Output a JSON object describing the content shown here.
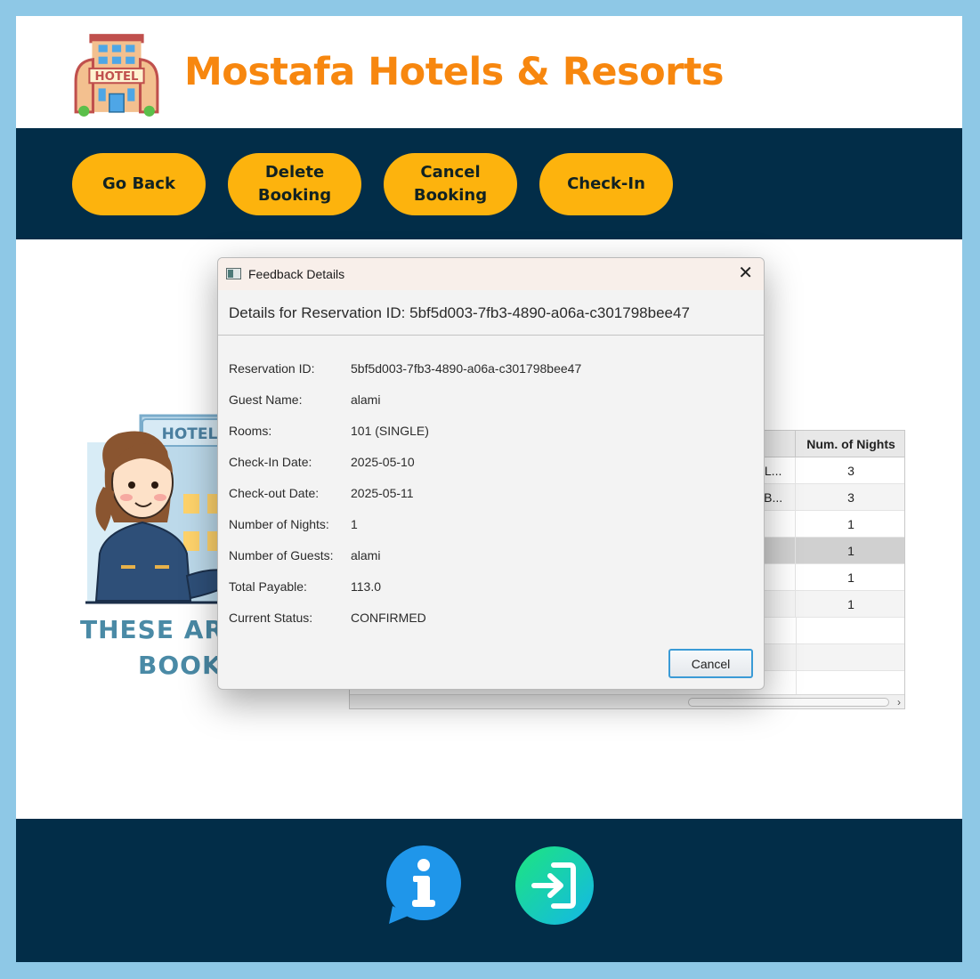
{
  "app": {
    "title": "Mostafa Hotels & Resorts",
    "logo_text": "HOTEL"
  },
  "toolbar": {
    "buttons": [
      {
        "id": "go-back",
        "lines": [
          "Go Back"
        ]
      },
      {
        "id": "delete-booking",
        "lines": [
          "Delete",
          "Booking"
        ]
      },
      {
        "id": "cancel-booking",
        "lines": [
          "Cancel",
          "Booking"
        ]
      },
      {
        "id": "check-in",
        "lines": [
          "Check-In"
        ]
      }
    ]
  },
  "illustration": {
    "building_sign": "HOTEL",
    "banner_line1": "THESE ARE C",
    "banner_line2": "BOOKI"
  },
  "table": {
    "header_num_nights": "Num. of Nights",
    "rows": [
      {
        "room_type": "GL...",
        "nights": "3",
        "selected": false
      },
      {
        "room_type": "UB...",
        "nights": "3",
        "selected": false
      },
      {
        "room_type": "",
        "nights": "1",
        "selected": false
      },
      {
        "room_type": "",
        "nights": "1",
        "selected": true
      },
      {
        "room_type": "",
        "nights": "1",
        "selected": false
      },
      {
        "room_type": "",
        "nights": "1",
        "selected": false
      },
      {
        "room_type": "",
        "nights": "",
        "selected": false
      },
      {
        "room_type": "",
        "nights": "",
        "selected": false
      },
      {
        "room_type": "",
        "nights": "",
        "selected": false
      }
    ]
  },
  "dialog": {
    "window_title": "Feedback Details",
    "header": "Details for Reservation ID: 5bf5d003-7fb3-4890-a06a-c301798bee47",
    "fields": [
      {
        "label": "Reservation ID:",
        "value": "5bf5d003-7fb3-4890-a06a-c301798bee47"
      },
      {
        "label": "Guest Name:",
        "value": "alami"
      },
      {
        "label": "Rooms:",
        "value": "101 (SINGLE)"
      },
      {
        "label": "Check-In Date:",
        "value": "2025-05-10"
      },
      {
        "label": "Check-out Date:",
        "value": "2025-05-11"
      },
      {
        "label": "Number of Nights:",
        "value": "1"
      },
      {
        "label": "Number of Guests:",
        "value": "alami"
      },
      {
        "label": "Total Payable:",
        "value": "113.0"
      },
      {
        "label": "Current Status:",
        "value": "CONFIRMED"
      }
    ],
    "cancel_label": "Cancel"
  },
  "footer": {
    "icons": [
      "info-icon",
      "logout-icon"
    ]
  },
  "colors": {
    "frame_bg": "#8ec8e6",
    "dark_navy": "#022d48",
    "button_yellow": "#fdb30d",
    "title_orange": "#f7870f",
    "banner_teal": "#4a8aa6"
  }
}
